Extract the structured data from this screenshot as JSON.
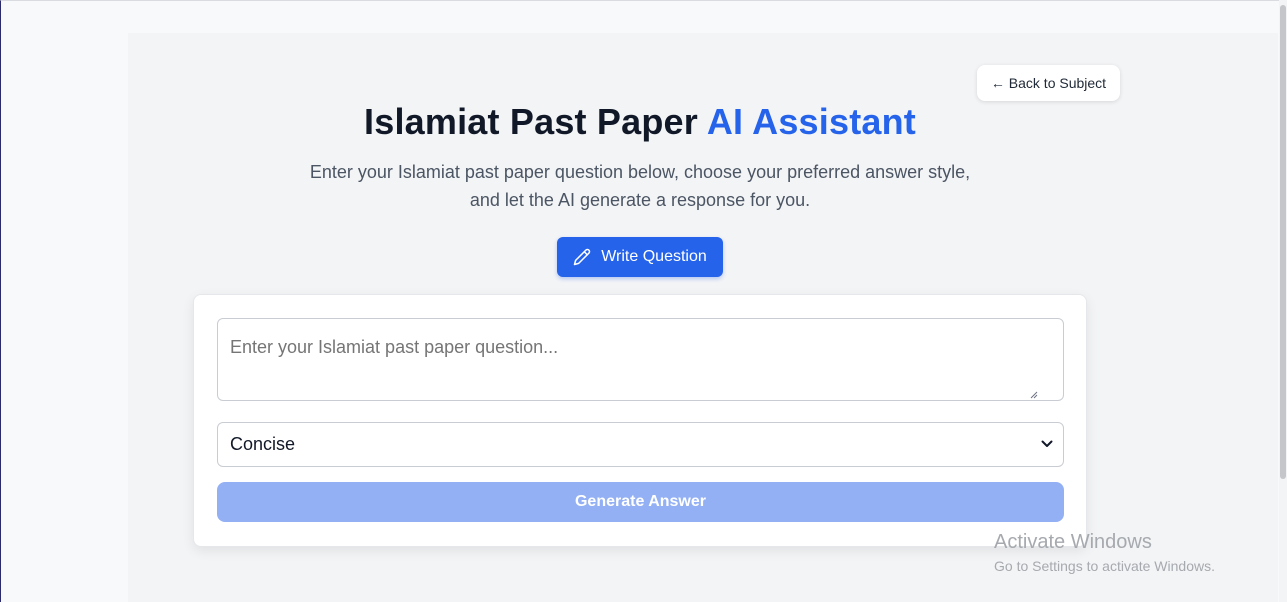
{
  "nav": {
    "back_label": "← Back to Subject"
  },
  "header": {
    "title_main": "Islamiat Past Paper ",
    "title_accent": "AI Assistant",
    "subtitle_line1": "Enter your Islamiat past paper question below, choose your preferred answer style,",
    "subtitle_line2": "and let the AI generate a response for you."
  },
  "mode": {
    "write_label": "Write Question",
    "icon": "pencil-icon"
  },
  "form": {
    "question_placeholder": "Enter your Islamiat past paper question...",
    "question_value": "",
    "style_selected": "Concise",
    "generate_label": "Generate Answer"
  },
  "overlay": {
    "activate_title": "Activate Windows",
    "activate_sub": "Go to Settings to activate Windows."
  },
  "colors": {
    "accent": "#2563eb",
    "generate_disabled": "#93b0f5",
    "text": "#111827",
    "muted": "#4b5563"
  }
}
